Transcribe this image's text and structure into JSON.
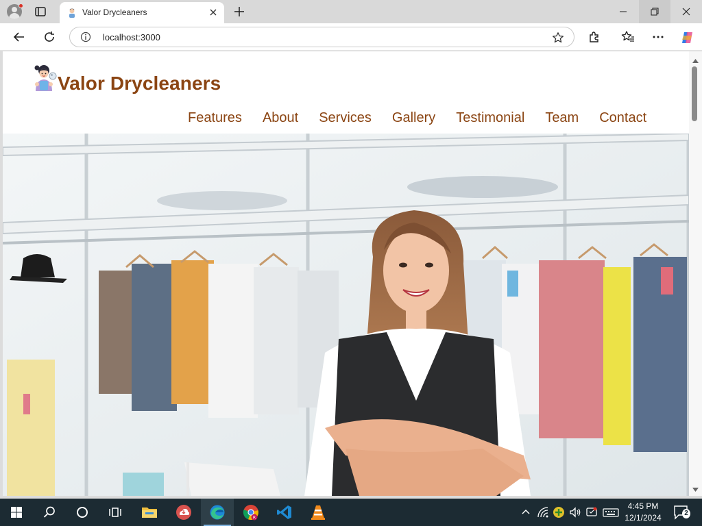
{
  "browser": {
    "tab": {
      "title": "Valor Drycleaners",
      "favicon": "woman-avatar-icon"
    },
    "address": {
      "url": "localhost:3000"
    },
    "window_controls": [
      "minimize-icon",
      "restore-icon",
      "close-icon"
    ]
  },
  "site": {
    "brand": "Valor Drycleaners",
    "brand_color": "#8b4513",
    "nav": [
      "Features",
      "About",
      "Services",
      "Gallery",
      "Testimonial",
      "Team",
      "Contact"
    ],
    "hero": {
      "subject": "smiling-woman-in-laundry-store",
      "background": "clothes-on-rack"
    }
  },
  "taskbar": {
    "apps": [
      "windows-start-icon",
      "search-icon",
      "cortana-icon",
      "task-view-icon",
      "file-explorer-icon",
      "cloud-app-icon",
      "edge-icon",
      "chrome-icon",
      "vscode-icon",
      "vlc-icon"
    ],
    "clock": {
      "time": "4:45 PM",
      "date": "12/1/2024"
    },
    "notifications": "2"
  }
}
